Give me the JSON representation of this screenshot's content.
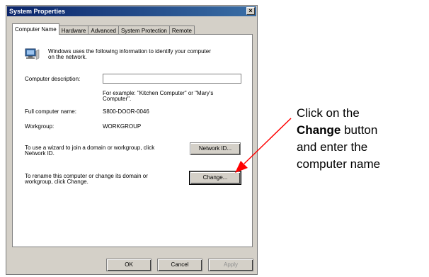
{
  "window": {
    "title": "System Properties",
    "close_glyph": "×"
  },
  "tabs": [
    {
      "label": "Computer Name",
      "active": true
    },
    {
      "label": "Hardware",
      "active": false
    },
    {
      "label": "Advanced",
      "active": false
    },
    {
      "label": "System Protection",
      "active": false
    },
    {
      "label": "Remote",
      "active": false
    }
  ],
  "panel": {
    "intro_line1": "Windows uses the following information to identify your computer",
    "intro_line2": "on the network.",
    "description_label": "Computer description:",
    "description_value": "",
    "example_line1": "For example: \"Kitchen Computer\" or \"Mary's",
    "example_line2": "Computer\".",
    "full_name_label": "Full computer name:",
    "full_name_value": "S800-DOOR-0046",
    "workgroup_label": "Workgroup:",
    "workgroup_value": "WORKGROUP",
    "network_text_line1": "To use a wizard to join a domain or workgroup, click",
    "network_text_line2": "Network ID.",
    "network_id_button": "Network ID...",
    "rename_text_line1": "To rename this computer or change its domain or",
    "rename_text_line2": "workgroup, click Change.",
    "change_button": "Change..."
  },
  "footer": {
    "ok_button": "OK",
    "cancel_button": "Cancel",
    "apply_button": "Apply"
  },
  "callout": {
    "line1": "Click on the",
    "line2_bold": "Change",
    "line2_rest": " button",
    "line3": "and enter the",
    "line4": "computer name",
    "color": "#ff0000"
  },
  "icons": {
    "computer": "computer-network-icon"
  }
}
